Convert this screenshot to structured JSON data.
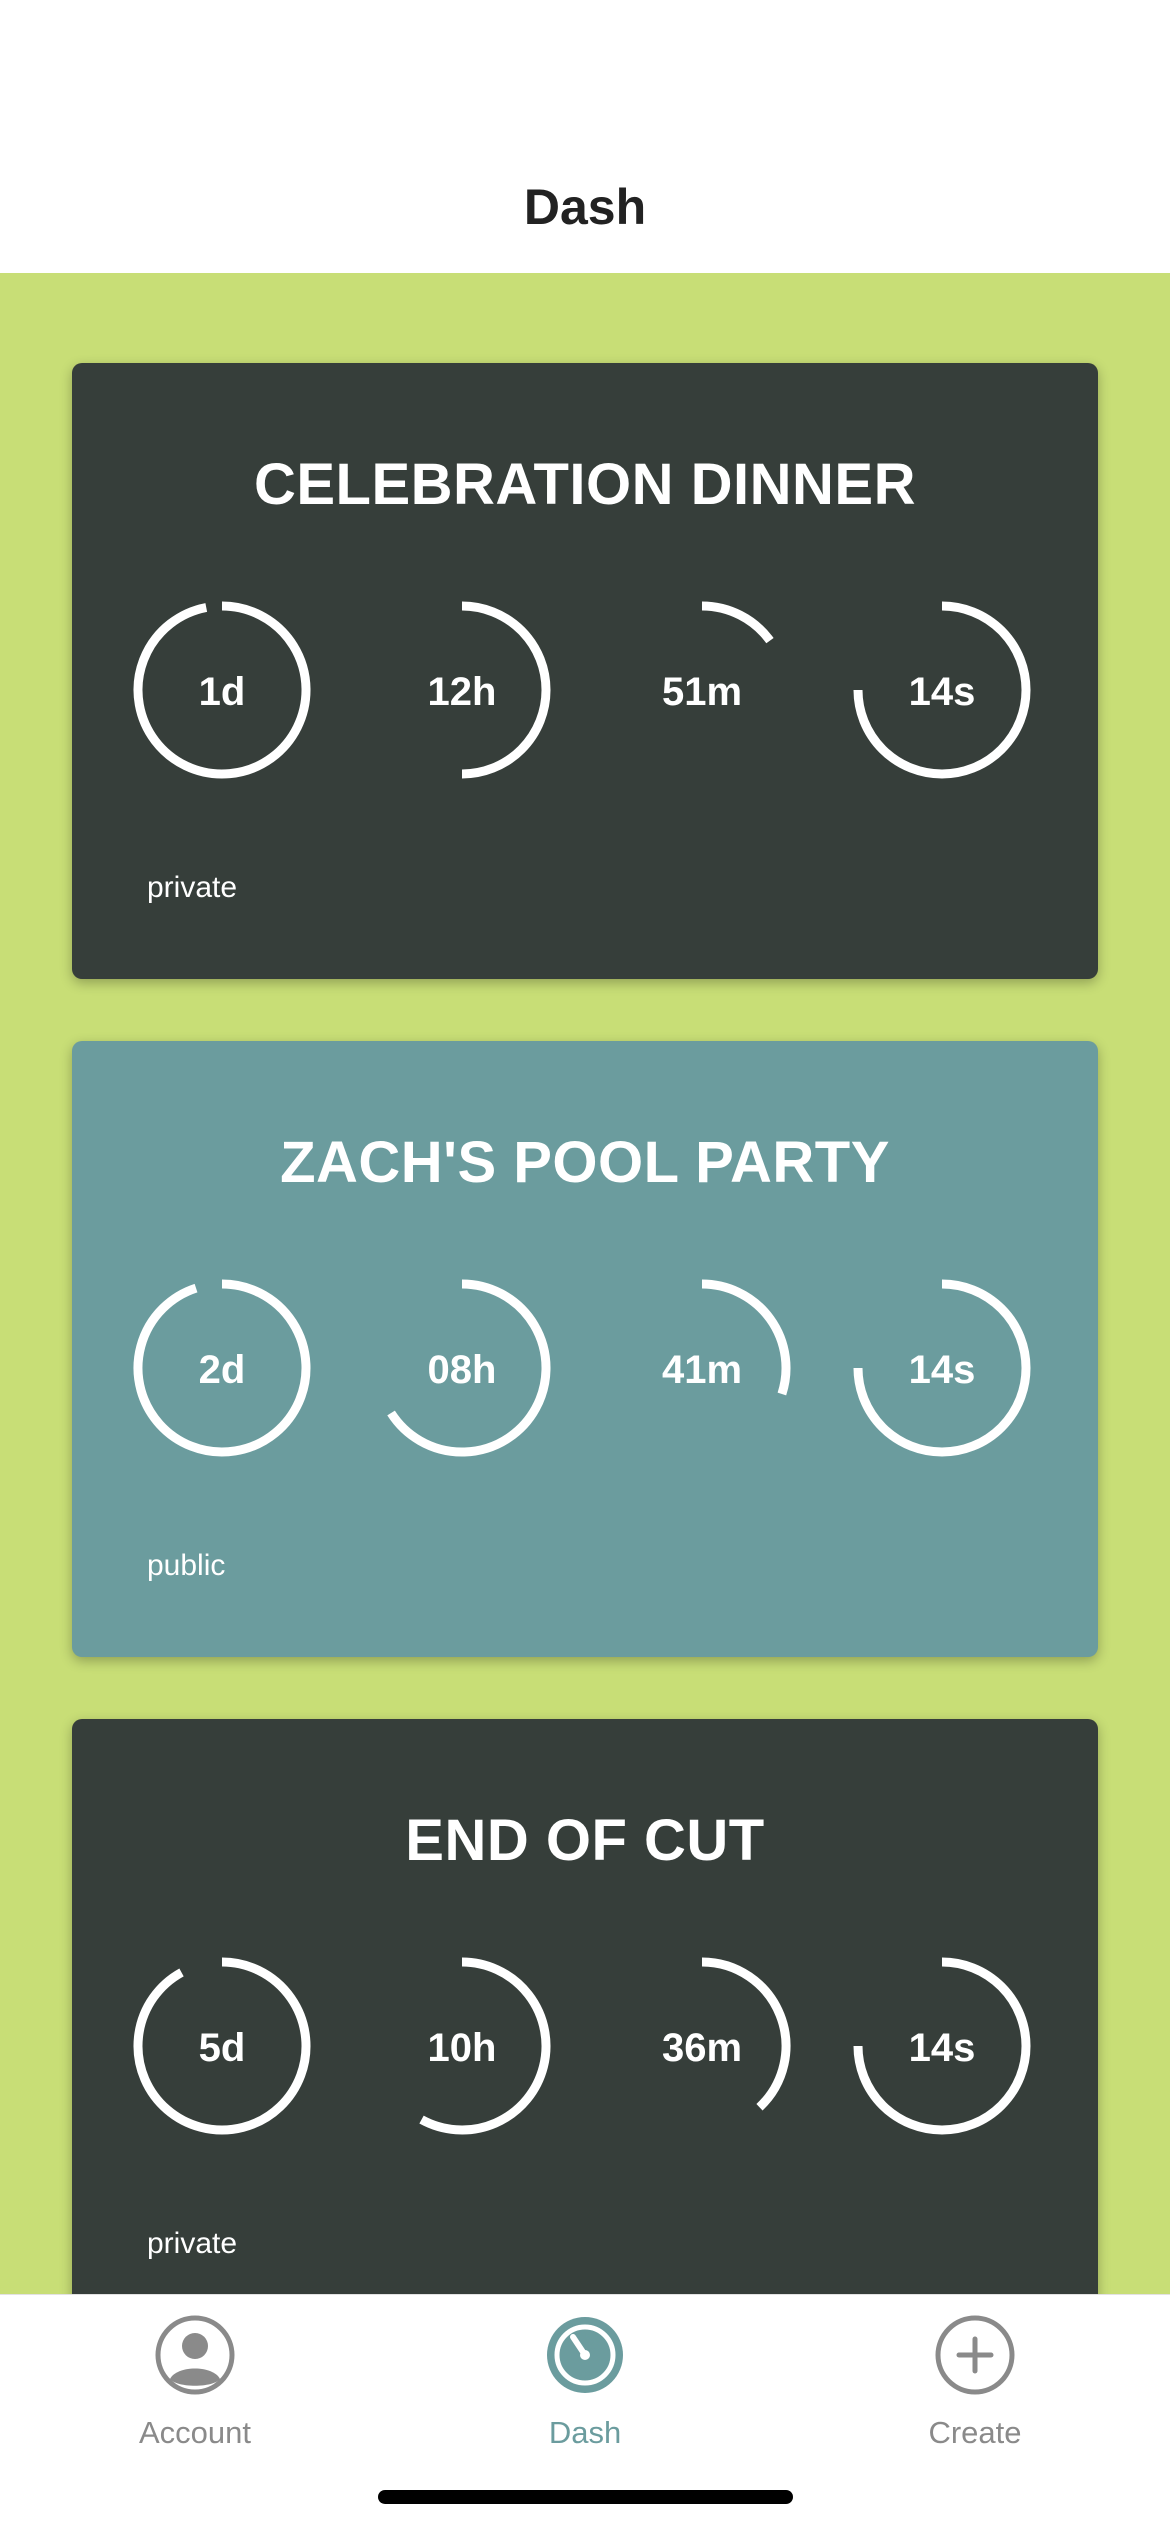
{
  "header": {
    "title": "Dash"
  },
  "colors": {
    "background": "#c8de76",
    "card_dark": "#363e3a",
    "card_teal": "#6b9c9e",
    "ring": "#ffffff",
    "tab_active": "#6b9c9e",
    "tab_inactive": "#8a8a8a"
  },
  "cards": [
    {
      "title": "CELEBRATION DINNER",
      "visibility": "private",
      "theme": "dark",
      "rings": [
        {
          "label": "1d",
          "fraction": 0.97,
          "unit": "days"
        },
        {
          "label": "12h",
          "fraction": 0.5,
          "unit": "hours"
        },
        {
          "label": "51m",
          "fraction": 0.15,
          "unit": "minutes"
        },
        {
          "label": "14s",
          "fraction": 0.75,
          "unit": "seconds"
        }
      ]
    },
    {
      "title": "ZACH'S POOL PARTY",
      "visibility": "public",
      "theme": "teal",
      "rings": [
        {
          "label": "2d",
          "fraction": 0.95,
          "unit": "days"
        },
        {
          "label": "08h",
          "fraction": 0.66,
          "unit": "hours"
        },
        {
          "label": "41m",
          "fraction": 0.3,
          "unit": "minutes"
        },
        {
          "label": "14s",
          "fraction": 0.75,
          "unit": "seconds"
        }
      ]
    },
    {
      "title": "END OF CUT",
      "visibility": "private",
      "theme": "dark",
      "rings": [
        {
          "label": "5d",
          "fraction": 0.92,
          "unit": "days"
        },
        {
          "label": "10h",
          "fraction": 0.58,
          "unit": "hours"
        },
        {
          "label": "36m",
          "fraction": 0.38,
          "unit": "minutes"
        },
        {
          "label": "14s",
          "fraction": 0.75,
          "unit": "seconds"
        }
      ]
    }
  ],
  "tabs": [
    {
      "label": "Account",
      "icon": "account-icon",
      "active": false
    },
    {
      "label": "Dash",
      "icon": "dash-icon",
      "active": true
    },
    {
      "label": "Create",
      "icon": "create-icon",
      "active": false
    }
  ]
}
